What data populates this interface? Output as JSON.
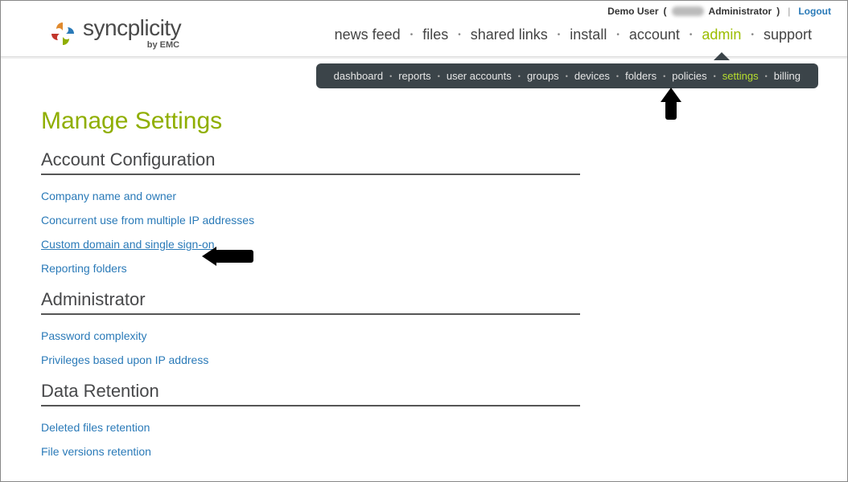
{
  "topbar": {
    "username": "Demo User",
    "role_open": "(",
    "role_text": "Administrator",
    "role_close": ")",
    "separator": "|",
    "logout": "Logout"
  },
  "logo": {
    "brand": "syncplicity",
    "byline": "by EMC"
  },
  "mainnav": {
    "items": [
      {
        "label": "news feed",
        "active": false
      },
      {
        "label": "files",
        "active": false
      },
      {
        "label": "shared links",
        "active": false
      },
      {
        "label": "install",
        "active": false
      },
      {
        "label": "account",
        "active": false
      },
      {
        "label": "admin",
        "active": true
      },
      {
        "label": "support",
        "active": false
      }
    ]
  },
  "subnav": {
    "items": [
      {
        "label": "dashboard",
        "active": false
      },
      {
        "label": "reports",
        "active": false
      },
      {
        "label": "user accounts",
        "active": false
      },
      {
        "label": "groups",
        "active": false
      },
      {
        "label": "devices",
        "active": false
      },
      {
        "label": "folders",
        "active": false
      },
      {
        "label": "policies",
        "active": false
      },
      {
        "label": "settings",
        "active": true
      },
      {
        "label": "billing",
        "active": false
      }
    ]
  },
  "page": {
    "title": "Manage Settings",
    "sections": [
      {
        "heading": "Account Configuration",
        "links": [
          {
            "label": "Company name and owner",
            "underlined": false
          },
          {
            "label": "Concurrent use from multiple IP addresses",
            "underlined": false
          },
          {
            "label": "Custom domain and single sign-on",
            "underlined": true
          },
          {
            "label": "Reporting folders",
            "underlined": false
          }
        ]
      },
      {
        "heading": "Administrator",
        "links": [
          {
            "label": "Password complexity",
            "underlined": false
          },
          {
            "label": "Privileges based upon IP address",
            "underlined": false
          }
        ]
      },
      {
        "heading": "Data Retention",
        "links": [
          {
            "label": "Deleted files retention",
            "underlined": false
          },
          {
            "label": "File versions retention",
            "underlined": false
          }
        ]
      }
    ]
  }
}
